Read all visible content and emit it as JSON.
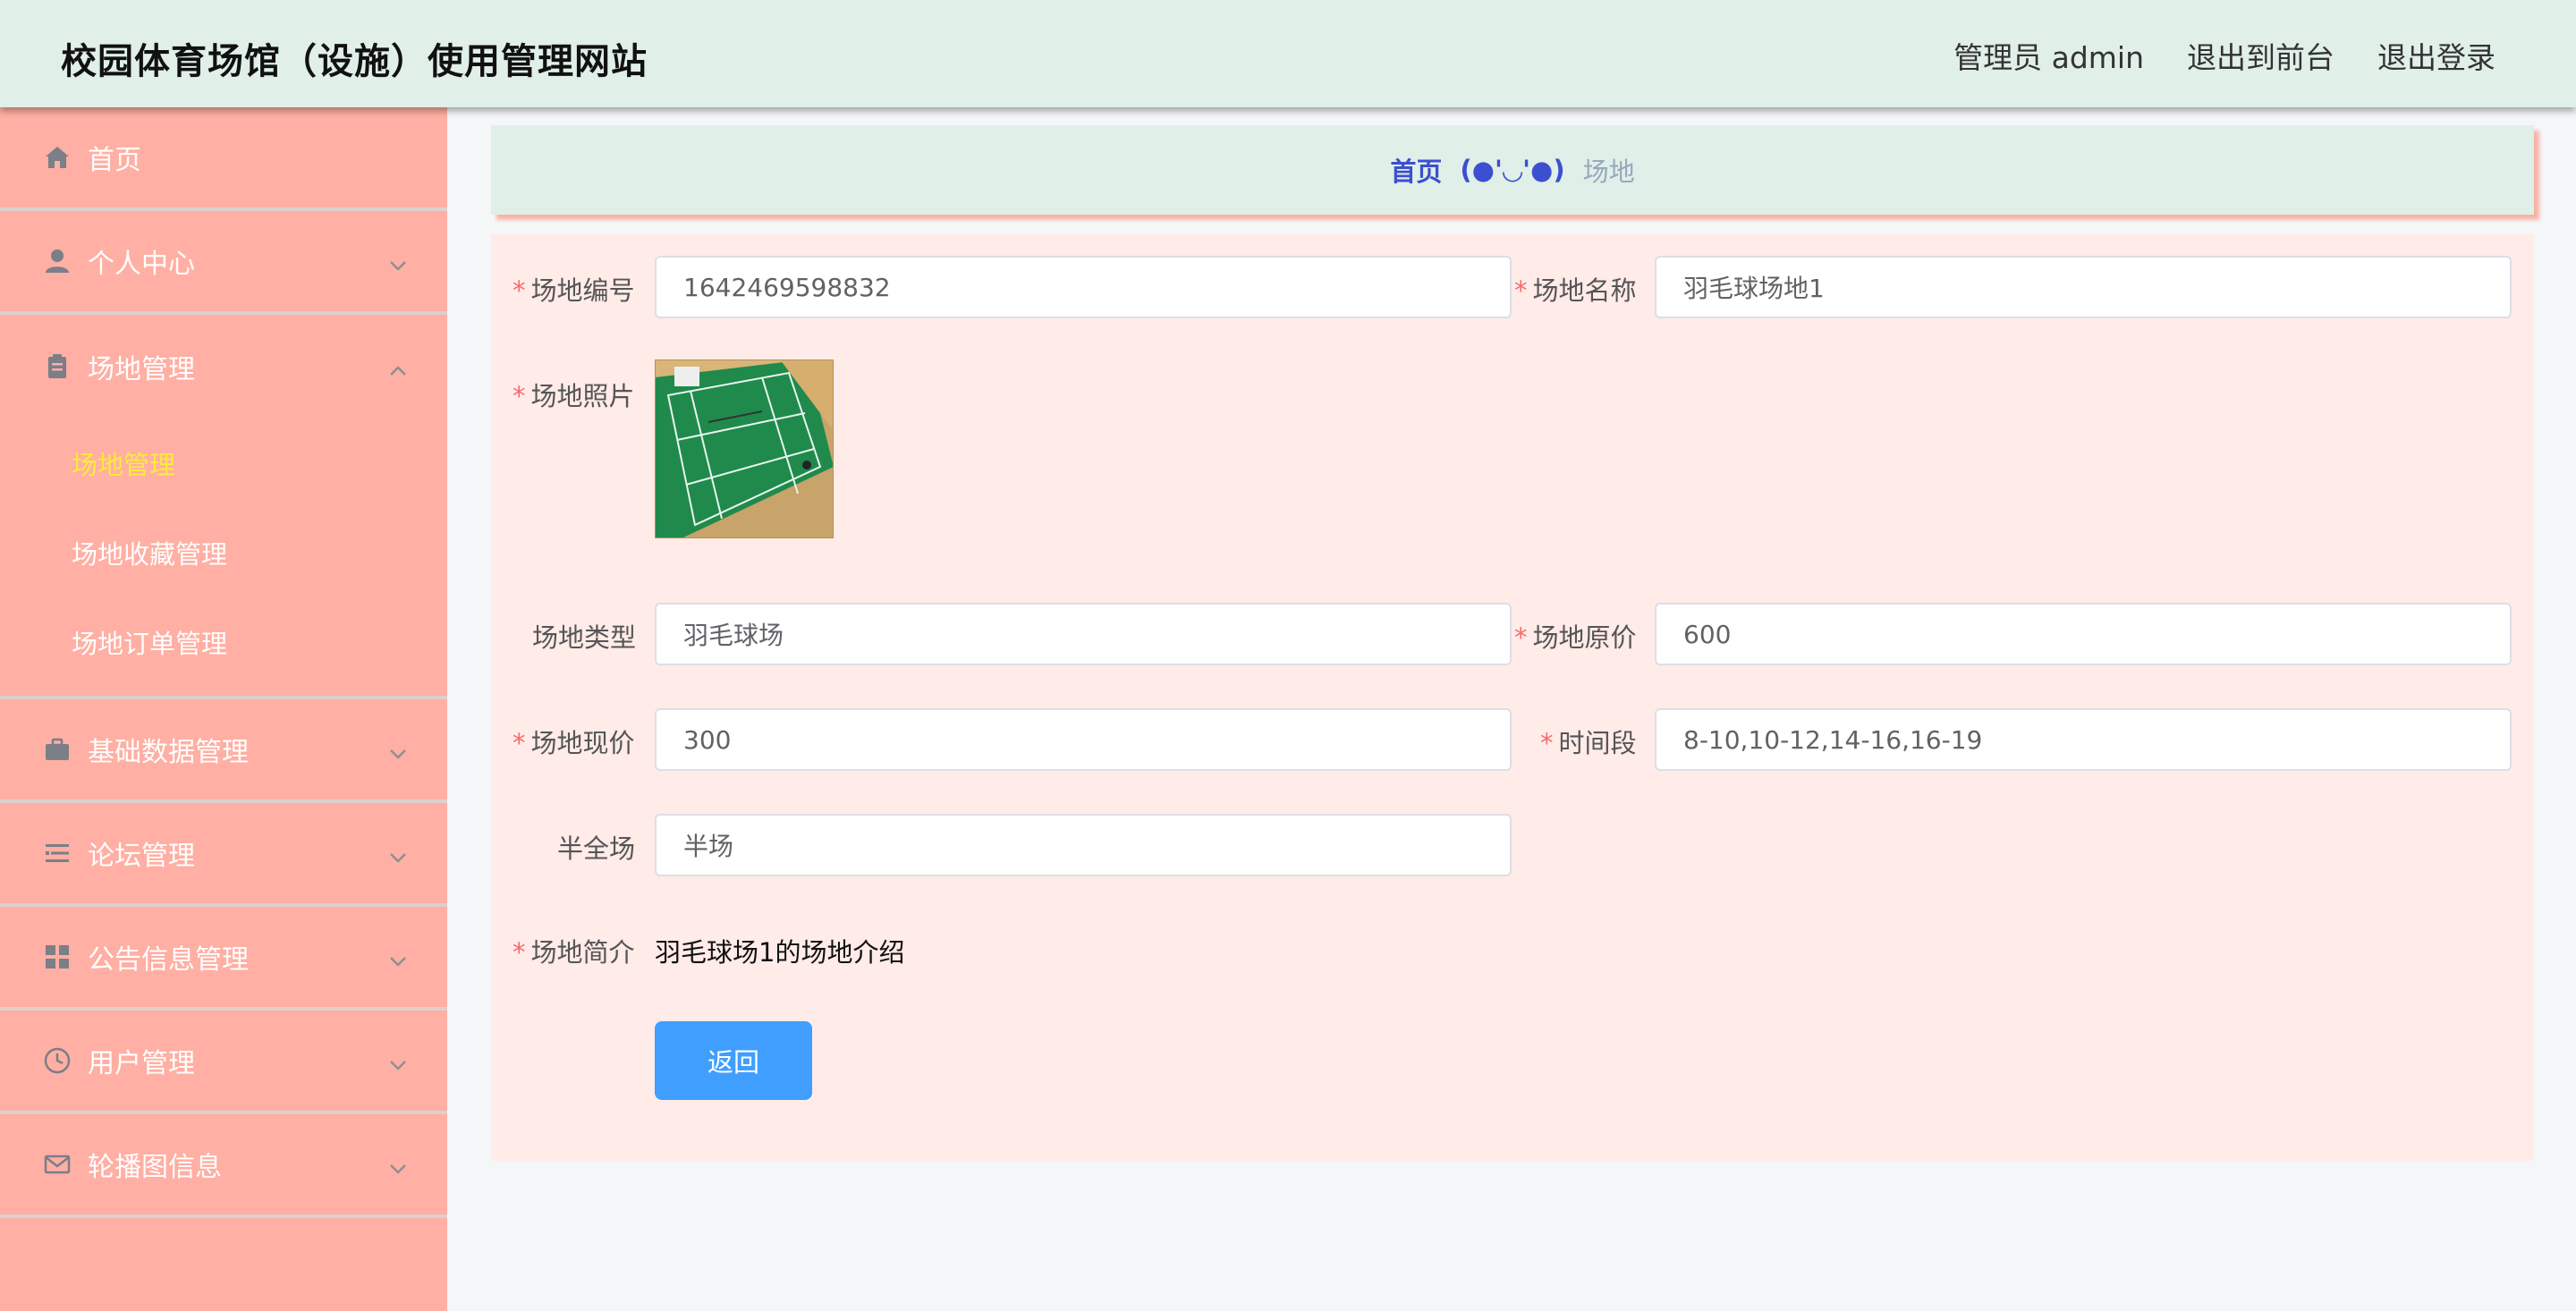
{
  "header": {
    "title": "校园体育场馆（设施）使用管理网站",
    "admin_label": "管理员 admin",
    "front_link": "退出到前台",
    "logout_link": "退出登录"
  },
  "sidebar": {
    "items": [
      {
        "label": "首页",
        "icon": "home-icon"
      },
      {
        "label": "个人中心",
        "icon": "user-icon"
      },
      {
        "label": "场地管理",
        "icon": "clipboard-icon"
      },
      {
        "label": "基础数据管理",
        "icon": "briefcase-icon"
      },
      {
        "label": "论坛管理",
        "icon": "list-icon"
      },
      {
        "label": "公告信息管理",
        "icon": "grid-icon"
      },
      {
        "label": "用户管理",
        "icon": "clock-icon"
      },
      {
        "label": "轮播图信息",
        "icon": "mail-icon"
      }
    ],
    "submenu": [
      "场地管理",
      "场地收藏管理",
      "场地订单管理"
    ]
  },
  "breadcrumb": {
    "home": "首页",
    "separator": "(●'◡'●)",
    "current": "场地"
  },
  "form": {
    "code_label": "场地编号",
    "code_value": "1642469598832",
    "name_label": "场地名称",
    "name_value": "羽毛球场地1",
    "photo_label": "场地照片",
    "type_label": "场地类型",
    "type_value": "羽毛球场",
    "orig_price_label": "场地原价",
    "orig_price_value": "600",
    "cur_price_label": "场地现价",
    "cur_price_value": "300",
    "time_label": "时间段",
    "time_value": "8-10,10-12,14-16,16-19",
    "half_label": "半全场",
    "half_value": "半场",
    "intro_label": "场地简介",
    "intro_value": "羽毛球场1的场地介绍",
    "back_button": "返回"
  },
  "colors": {
    "header_bg": "#e0efe7",
    "sidebar_bg": "#ffafa3",
    "panel_bg": "#ffebe8",
    "accent": "#409eff",
    "active_sub": "#ffeb3b",
    "required": "#f56c6c"
  }
}
